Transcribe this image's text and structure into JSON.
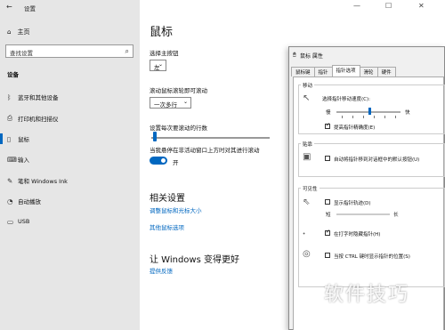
{
  "window": {
    "title": "设置",
    "back_icon": "back-arrow-icon"
  },
  "sidebar": {
    "home": "主页",
    "search_placeholder": "查找设置",
    "section": "设备",
    "items": [
      {
        "icon": "bluetooth-icon",
        "label": "蓝牙和其他设备"
      },
      {
        "icon": "printer-icon",
        "label": "打印机和扫描仪"
      },
      {
        "icon": "mouse-icon",
        "label": "鼠标"
      },
      {
        "icon": "keyboard-icon",
        "label": "输入"
      },
      {
        "icon": "pen-icon",
        "label": "笔和 Windows Ink"
      },
      {
        "icon": "autoplay-icon",
        "label": "自动播放"
      },
      {
        "icon": "usb-icon",
        "label": "USB"
      }
    ]
  },
  "main": {
    "title": "鼠标",
    "primary_button_label": "选择主按钮",
    "primary_button_value": "左",
    "scroll_label": "滚动鼠标滚轮即可滚动",
    "scroll_value": "一次多行",
    "lines_label": "设置每次要滚动的行数",
    "inactive_label": "当我悬停在非活动窗口上方时对其进行滚动",
    "inactive_state": "开",
    "related_title": "相关设置",
    "related_link1": "调整鼠标和光标大小",
    "related_link2": "其他鼠标选项",
    "better_title": "让 Windows 变得更好",
    "feedback_link": "提供反馈"
  },
  "dialog": {
    "title": "鼠标 属性",
    "tabs": [
      "鼠标键",
      "指针",
      "指针选项",
      "滑轮",
      "硬件"
    ],
    "selected_tab": "指针选项",
    "motion": {
      "group": "移动",
      "speed_label": "选择指针移动速度(C):",
      "slow": "慢",
      "fast": "快",
      "precision": "提高指针精确度(E)",
      "precision_checked": true
    },
    "snap": {
      "group": "贴靠",
      "label": "自动将指针移到对话框中的默认按钮(U)",
      "checked": false
    },
    "visibility": {
      "group": "可见性",
      "trails": "显示指针轨迹(D)",
      "trails_checked": false,
      "short": "短",
      "long": "长",
      "hide": "在打字时隐藏指针(H)",
      "hide_checked": true,
      "ctrl": "当按 CTRL 键时显示指针的位置(S)",
      "ctrl_checked": false
    }
  },
  "watermark": "软件技巧"
}
